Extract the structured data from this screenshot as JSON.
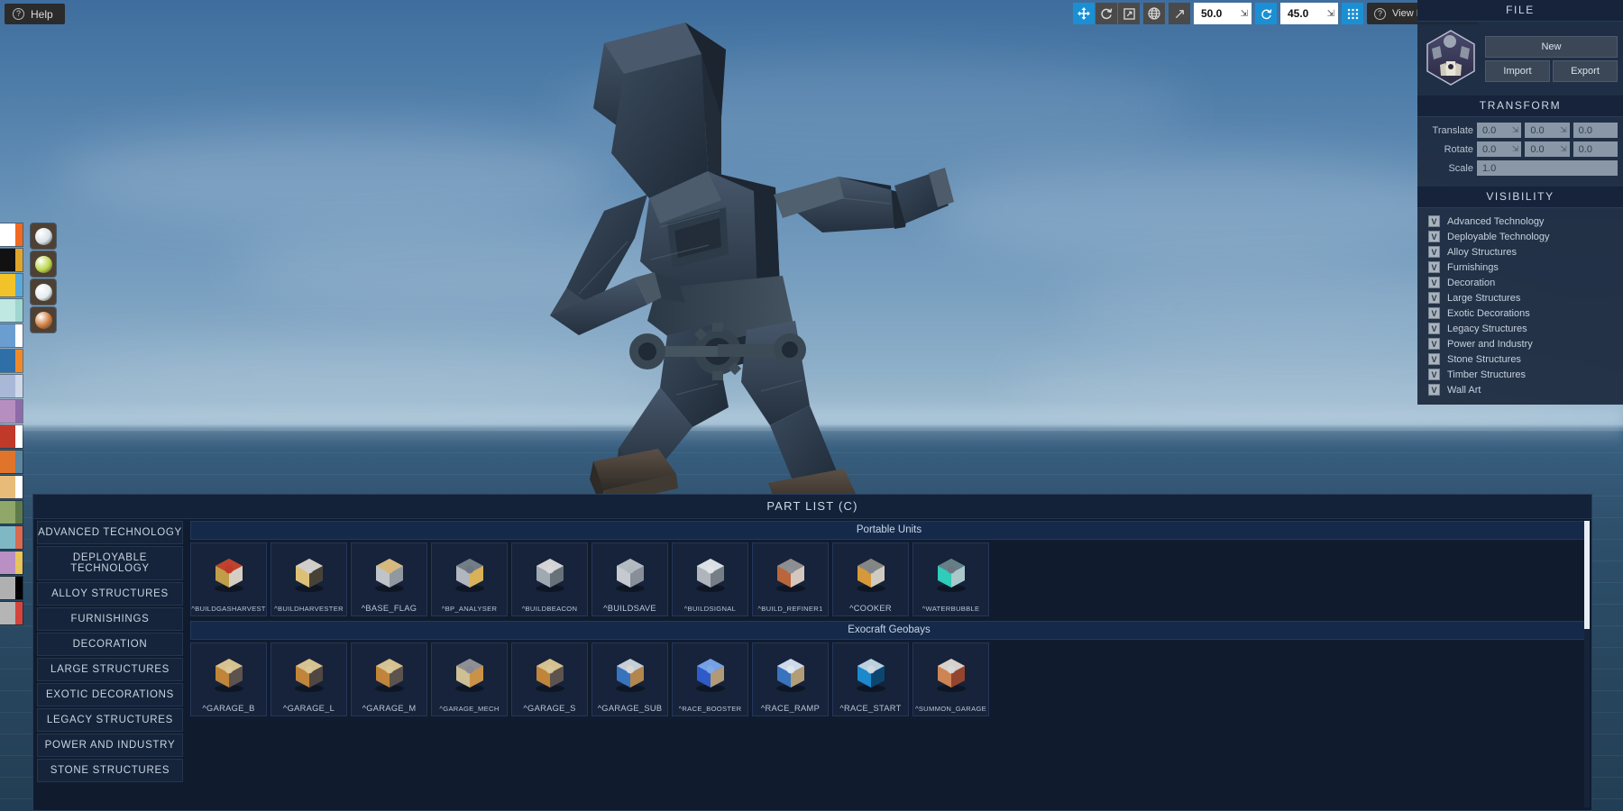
{
  "app": {
    "help_label": "Help",
    "help_icon": "question-circle-icon"
  },
  "toolbar": {
    "tools": [
      {
        "name": "translate-tool",
        "icon": "move-arrows-icon",
        "active": true
      },
      {
        "name": "rotate-tool",
        "icon": "rotate-icon",
        "active": false
      },
      {
        "name": "scale-tool",
        "icon": "scale-icon",
        "active": false
      }
    ],
    "globe": {
      "name": "world-space-toggle",
      "icon": "globe-icon"
    },
    "snap_move": {
      "name": "snap-translate-field",
      "icon": "diagonal-arrow-icon",
      "value": "50.0",
      "spinner": "spinner-icon"
    },
    "snap_rotate": {
      "name": "snap-rotate-field",
      "icon": "rotate-snap-icon",
      "value": "45.0",
      "spinner": "spinner-icon"
    },
    "grid": {
      "name": "grid-toggle",
      "icon": "grid-dots-icon"
    },
    "hotkeys": {
      "label": "View Hotkeys (H)",
      "icon": "question-circle-icon"
    }
  },
  "palette": {
    "swatches": [
      {
        "a": "#ffffff",
        "b": "#f26a20"
      },
      {
        "a": "#111111",
        "b": "#e0a42a"
      },
      {
        "a": "#f2c329",
        "b": "#5aa9d8"
      },
      {
        "a": "#bfe8e2",
        "b": "#9fd6cf"
      },
      {
        "a": "#6b9ed0",
        "b": "#ffffff"
      },
      {
        "a": "#2f6fa8",
        "b": "#f08a28"
      },
      {
        "a": "#aab8d8",
        "b": "#cfd8e8"
      },
      {
        "a": "#b68fc0",
        "b": "#8d6ba8"
      },
      {
        "a": "#c0392b",
        "b": "#ffffff"
      },
      {
        "a": "#e0742a",
        "b": "#5d86a0"
      },
      {
        "a": "#e8bb78",
        "b": "#ffffff"
      },
      {
        "a": "#8fa86a",
        "b": "#5f7a4a"
      },
      {
        "a": "#7fb8c4",
        "b": "#d9694f"
      },
      {
        "a": "#b98fc4",
        "b": "#e8c45a"
      },
      {
        "a": "#b0b0b0",
        "b": "#000000"
      },
      {
        "a": "#b5b5b5",
        "b": "#d4443c"
      }
    ],
    "orbs": [
      {
        "name": "material-orb-metal",
        "color": "#d8e2e8"
      },
      {
        "name": "material-orb-green",
        "color": "#bcd64a"
      },
      {
        "name": "material-orb-silver",
        "color": "#e6ecef"
      },
      {
        "name": "material-orb-copper",
        "color": "#cf7a3a"
      }
    ]
  },
  "right_panel": {
    "file": {
      "title": "FILE",
      "emblem_icon": "nms-base-emblem-icon",
      "new_label": "New",
      "import_label": "Import",
      "export_label": "Export"
    },
    "transform": {
      "title": "TRANSFORM",
      "rows": [
        {
          "label": "Translate",
          "values": [
            "0.0",
            "0.0",
            "0.0"
          ],
          "spinners": 3
        },
        {
          "label": "Rotate",
          "values": [
            "0.0",
            "0.0",
            "0.0"
          ],
          "spinners": 3
        }
      ],
      "scale": {
        "label": "Scale",
        "value": "1.0"
      }
    },
    "visibility": {
      "title": "VISIBILITY",
      "check_glyph": "V",
      "items": [
        "Advanced Technology",
        "Deployable Technology",
        "Alloy Structures",
        "Furnishings",
        "Decoration",
        "Large Structures",
        "Exotic Decorations",
        "Legacy Structures",
        "Power and Industry",
        "Stone Structures",
        "Timber Structures",
        "Wall Art"
      ]
    }
  },
  "part_list": {
    "title": "PART LIST (C)",
    "categories": [
      "ADVANCED TECHNOLOGY",
      "DEPLOYABLE TECHNOLOGY",
      "ALLOY STRUCTURES",
      "FURNISHINGS",
      "DECORATION",
      "LARGE STRUCTURES",
      "EXOTIC DECORATIONS",
      "LEGACY STRUCTURES",
      "POWER AND INDUSTRY",
      "STONE STRUCTURES"
    ],
    "sections": [
      {
        "name": "Portable Units",
        "items": [
          {
            "label": "^BUILDGASHARVEST",
            "size": "small",
            "icon": "gas-harvester-icon",
            "c1": "#c9a44a",
            "c2": "#d8d8d8",
            "c3": "#c0392b"
          },
          {
            "label": "^BUILDHARVESTER",
            "size": "small",
            "icon": "harvester-icon",
            "c1": "#e8c97a",
            "c2": "#2b2b2b",
            "c3": "#cfcfcf"
          },
          {
            "label": "^BASE_FLAG",
            "size": "big",
            "icon": "base-flag-icon",
            "c1": "#c8cdd2",
            "c2": "#8a9199",
            "c3": "#d8b878"
          },
          {
            "label": "^BP_ANALYSER",
            "size": "small",
            "icon": "blueprint-analyser-icon",
            "c1": "#b9bfc6",
            "c2": "#e0b045",
            "c3": "#6d7781"
          },
          {
            "label": "^BUILDBEACON",
            "size": "small",
            "icon": "beacon-icon",
            "c1": "#a8b0b8",
            "c2": "#5d6770",
            "c3": "#d8d8d8"
          },
          {
            "label": "^BUILDSAVE",
            "size": "big",
            "icon": "save-point-icon",
            "c1": "#cfd4d9",
            "c2": "#7c858e",
            "c3": "#b0b8c0"
          },
          {
            "label": "^BUILDSIGNAL",
            "size": "small",
            "icon": "signal-booster-icon",
            "c1": "#b8bec4",
            "c2": "#6b747d",
            "c3": "#e0e4e8"
          },
          {
            "label": "^BUILD_REFINER1",
            "size": "small",
            "icon": "portable-refiner-icon",
            "c1": "#c46a3a",
            "c2": "#d8d8d8",
            "c3": "#8a9199"
          },
          {
            "label": "^COOKER",
            "size": "big",
            "icon": "nutrient-processor-icon",
            "c1": "#e0a03a",
            "c2": "#cfd4d9",
            "c3": "#7c858e"
          },
          {
            "label": "^WATERBUBBLE",
            "size": "small",
            "icon": "water-bubble-icon",
            "c1": "#2fd6c0",
            "c2": "#c0c6cc",
            "c3": "#6d7781"
          }
        ]
      },
      {
        "name": "Exocraft Geobays",
        "items": [
          {
            "label": "^GARAGE_B",
            "size": "big",
            "icon": "garage-b-icon",
            "c1": "#c98a3a",
            "c2": "#4a4a52",
            "c3": "#d8c89a"
          },
          {
            "label": "^GARAGE_L",
            "size": "big",
            "icon": "garage-l-icon",
            "c1": "#c98a3a",
            "c2": "#3c3c44",
            "c3": "#d8c89a"
          },
          {
            "label": "^GARAGE_M",
            "size": "big",
            "icon": "garage-m-icon",
            "c1": "#c98a3a",
            "c2": "#4a4a52",
            "c3": "#d8c89a"
          },
          {
            "label": "^GARAGE_MECH",
            "size": "small",
            "icon": "garage-mech-icon",
            "c1": "#d8c89a",
            "c2": "#c98a3a",
            "c3": "#8a8a92"
          },
          {
            "label": "^GARAGE_S",
            "size": "big",
            "icon": "garage-s-icon",
            "c1": "#c98a3a",
            "c2": "#4a4a52",
            "c3": "#d8c89a"
          },
          {
            "label": "^GARAGE_SUB",
            "size": "big",
            "icon": "garage-sub-icon",
            "c1": "#3a78c4",
            "c2": "#c98a3a",
            "c3": "#d8d8d8"
          },
          {
            "label": "^RACE_BOOSTER",
            "size": "small",
            "icon": "race-booster-icon",
            "c1": "#2f5fd0",
            "c2": "#c9a46a",
            "c3": "#7fa8e8"
          },
          {
            "label": "^RACE_RAMP",
            "size": "big",
            "icon": "race-ramp-icon",
            "c1": "#3a78c4",
            "c2": "#c9a46a",
            "c3": "#dfe6ef"
          },
          {
            "label": "^RACE_START",
            "size": "big",
            "icon": "race-start-icon",
            "c1": "#1b8fd4",
            "c2": "#0a3a60",
            "c3": "#cfd8e0"
          },
          {
            "label": "^SUMMON_GARAGE",
            "size": "small",
            "icon": "summon-garage-icon",
            "c1": "#d98a55",
            "c2": "#8a3a2a",
            "c3": "#d8d8d8"
          }
        ]
      }
    ]
  }
}
